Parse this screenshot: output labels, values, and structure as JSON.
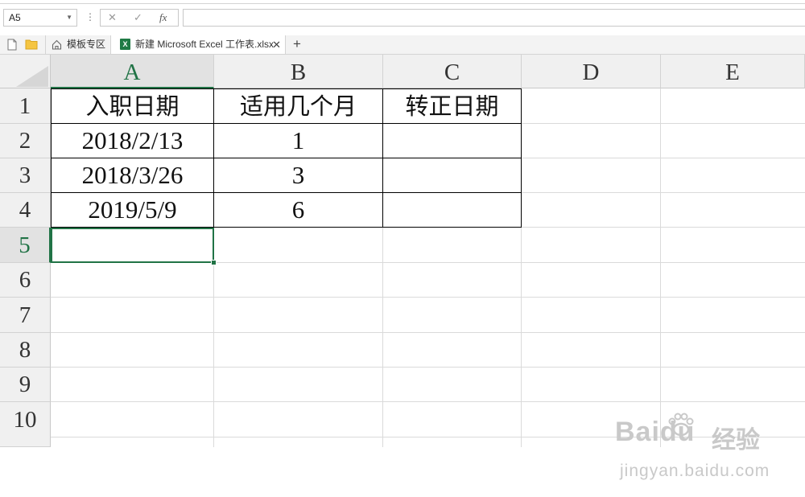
{
  "formula_bar": {
    "name_box": "A5",
    "cancel_icon": "✕",
    "confirm_icon": "✓",
    "fx_icon": "fx",
    "formula_value": ""
  },
  "tabs": {
    "home_label": "模板专区",
    "file_label": "新建 Microsoft Excel 工作表.xlsx",
    "file_badge": "X",
    "close_glyph": "✕",
    "add_glyph": "+"
  },
  "sheet": {
    "selected_cell": "A5",
    "columns": [
      "A",
      "B",
      "C",
      "D",
      "E"
    ],
    "rows": [
      "1",
      "2",
      "3",
      "4",
      "5",
      "6",
      "7",
      "8",
      "9",
      "10"
    ],
    "cells": {
      "A1": "入职日期",
      "B1": "适用几个月",
      "C1": "转正日期",
      "A2": "2018/2/13",
      "B2": "1",
      "C2": "",
      "A3": "2018/3/26",
      "B3": "3",
      "C3": "",
      "A4": "2019/5/9",
      "B4": "6",
      "C4": ""
    }
  },
  "watermark": {
    "brand": "Baidu",
    "suffix": "经验",
    "url": "jingyan.baidu.com"
  },
  "colors": {
    "accent": "#217346",
    "header_bg": "#f0f0f0",
    "gridline": "#dadada"
  }
}
